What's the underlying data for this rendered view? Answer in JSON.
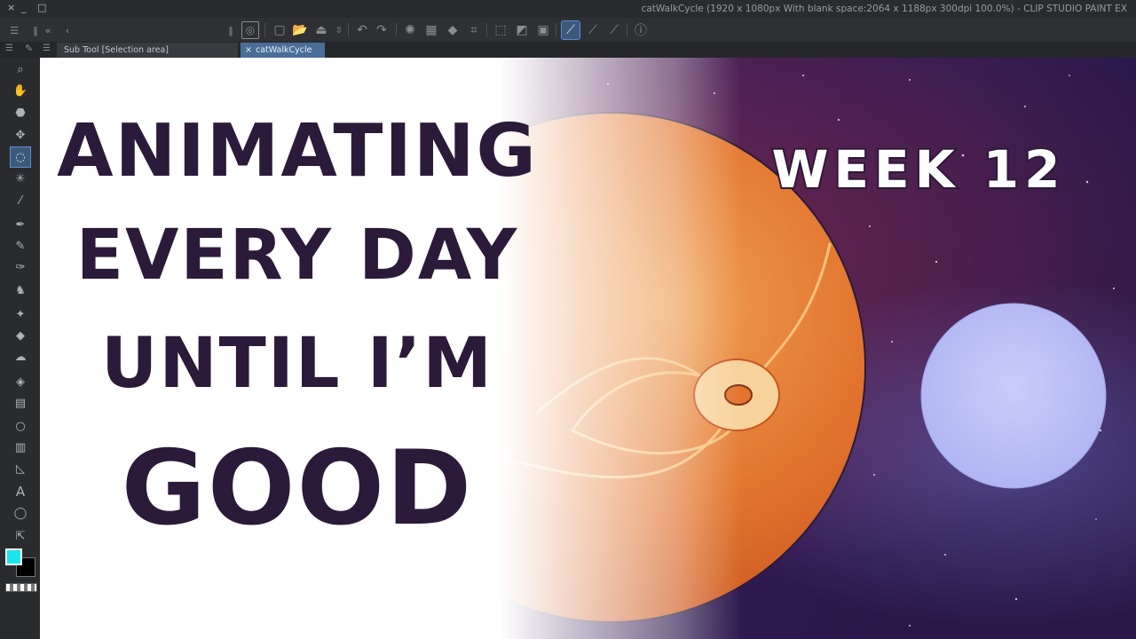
{
  "window": {
    "title": "catWalkCycle (1920 x 1080px With blank space:2064 x 1188px 300dpi 100.0%)  - CLIP STUDIO PAINT EX",
    "controls": [
      "×",
      "_",
      "□"
    ]
  },
  "panel": {
    "subtool_tab_label": "Sub Tool [Selection area]",
    "document_tab_label": "catWalkCycle",
    "document_tab_close": "×"
  },
  "toolbar": {
    "icons": [
      "clip-studio-icon",
      "new-icon",
      "open-icon",
      "save-icon",
      "spinner-icon",
      "undo-icon",
      "redo-icon",
      "loading-icon",
      "clear-icon",
      "fill-icon",
      "transform-icon",
      "deselect-icon",
      "invert-icon",
      "select-icon",
      "snap-ruler-icon",
      "snap-special-icon",
      "snap-grid-icon",
      "help-icon"
    ]
  },
  "tools": [
    "zoom-icon",
    "hand-icon",
    "rotate-icon",
    "move-icon",
    "lasso-select-icon",
    "magic-wand-icon",
    "eyedropper-icon",
    "pen-icon",
    "pencil-icon",
    "brush-icon",
    "airbrush-icon",
    "decoration-icon",
    "eraser-icon",
    "blend-icon",
    "fill-icon",
    "gradient-icon",
    "shape-icon",
    "frame-icon",
    "ruler-icon",
    "text-icon",
    "balloon-icon",
    "correction-icon"
  ],
  "colors": {
    "main_color": "#19e6ec",
    "sub_color": "#000000",
    "headline": "#2c1a3a",
    "accent": "#5b8ed0"
  },
  "artwork": {
    "headline_lines": [
      "ANIMATING",
      "EVERY DAY",
      "UNTIL I’M",
      "GOOD"
    ],
    "badge": "WEEK 12"
  }
}
